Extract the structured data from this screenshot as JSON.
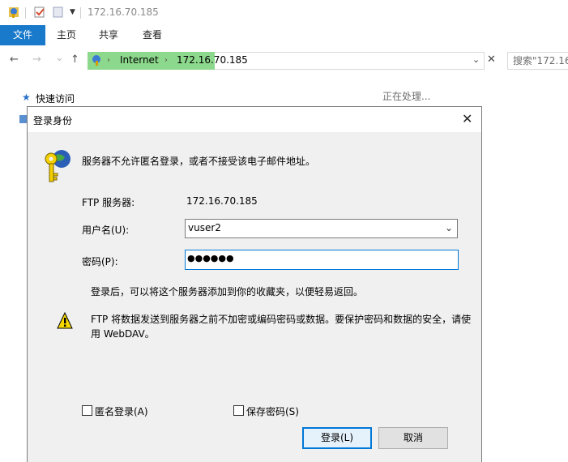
{
  "window": {
    "title": "172.16.70.185"
  },
  "ribbon": {
    "tabs": [
      "文件",
      "主页",
      "共享",
      "查看"
    ]
  },
  "nav": {
    "back": "←",
    "forward": "→",
    "recent": "⌄",
    "up": "↑",
    "address_parts": [
      "Internet",
      "172.16.70.185"
    ],
    "search_placeholder": "搜索\"172.16"
  },
  "sidebar": {
    "quick_access": "快速访问"
  },
  "content": {
    "status": "正在处理..."
  },
  "dialog": {
    "title": "登录身份",
    "message": "服务器不允许匿名登录，或者不接受该电子邮件地址。",
    "server_label": "FTP 服务器:",
    "server_value": "172.16.70.185",
    "username_label": "用户名(U):",
    "username_value": "vuser2",
    "password_label": "密码(P):",
    "password_mask": "●●●●●●",
    "info": "登录后，可以将这个服务器添加到你的收藏夹，以便轻易返回。",
    "warning_line1": "FTP 将数据发送到服务器之前不加密或编码密码或数据。要保护密码和数据的安全，请使",
    "warning_line2": "用 WebDAV。",
    "anonymous_label": "匿名登录(A)",
    "save_password_label": "保存密码(S)",
    "login_button": "登录(L)",
    "cancel_button": "取消"
  },
  "colors": {
    "accent": "#1979ca",
    "focus": "#0078d7",
    "address_progress": "#8cd88c"
  }
}
